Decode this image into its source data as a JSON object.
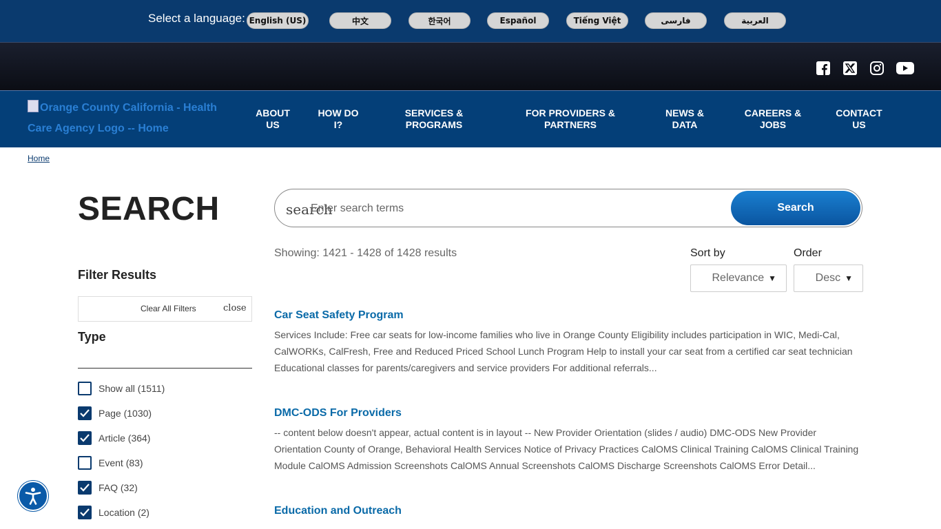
{
  "language_bar": {
    "label": "Select a language:",
    "languages": [
      "English (US)",
      "中文",
      "한국어",
      "Español",
      "Tiếng Việt",
      "فارسی",
      "العربية"
    ]
  },
  "social": {
    "icons": [
      "facebook-icon",
      "x-twitter-icon",
      "instagram-icon",
      "youtube-icon"
    ]
  },
  "header": {
    "logo_alt": "Orange County California - Health Care Agency Logo -- Home",
    "nav": [
      "ABOUT US",
      "HOW DO I?",
      "SERVICES & PROGRAMS",
      "FOR PROVIDERS & PARTNERS",
      "NEWS & DATA",
      "CAREERS & JOBS",
      "CONTACT US"
    ]
  },
  "breadcrumb": {
    "home": "Home"
  },
  "search": {
    "title": "SEARCH",
    "icon_fallback_text": "search",
    "placeholder": "Enter search terms",
    "button": "Search",
    "showing": "Showing: 1421 - 1428 of 1428 results",
    "sort_label": "Sort by",
    "sort_value": "Relevance",
    "order_label": "Order",
    "order_value": "Desc"
  },
  "filters": {
    "title": "Filter Results",
    "clear_all": "Clear All Filters",
    "close": "close",
    "type_title": "Type",
    "items": [
      {
        "label": "Show all (1511)",
        "checked": false
      },
      {
        "label": "Page (1030)",
        "checked": true
      },
      {
        "label": "Article (364)",
        "checked": true
      },
      {
        "label": "Event (83)",
        "checked": false
      },
      {
        "label": "FAQ (32)",
        "checked": true
      },
      {
        "label": "Location (2)",
        "checked": true
      }
    ]
  },
  "results": [
    {
      "title": "Car Seat Safety Program",
      "snippet": "Services Include: Free car seats for low-income families who live in Orange County Eligibility includes participation in WIC, Medi-Cal, CalWORKs, CalFresh, Free and Reduced Priced School Lunch Program Help to install your car seat from a certified car seat technician Educational classes for parents/caregivers and service providers For additional referrals..."
    },
    {
      "title": "DMC-ODS For Providers",
      "snippet": "-- content below doesn't appear, actual content is in layout -- New Provider Orientation (slides / audio) DMC-ODS New Provider Orientation County of Orange, Behavioral Health Services Notice of Privacy Practices CalOMS Clinical Training CalOMS Clinical Training Module CalOMS Admission Screenshots CalOMS Annual Screenshots CalOMS Discharge Screenshots CalOMS Error Detail..."
    },
    {
      "title": "Education and Outreach",
      "snippet": ""
    }
  ],
  "colors": {
    "lang_bar_bg": "#0a3a6e",
    "nav_bg": "#043f78",
    "accent": "#0a6aa8",
    "checkbox": "#0a3a6e"
  }
}
